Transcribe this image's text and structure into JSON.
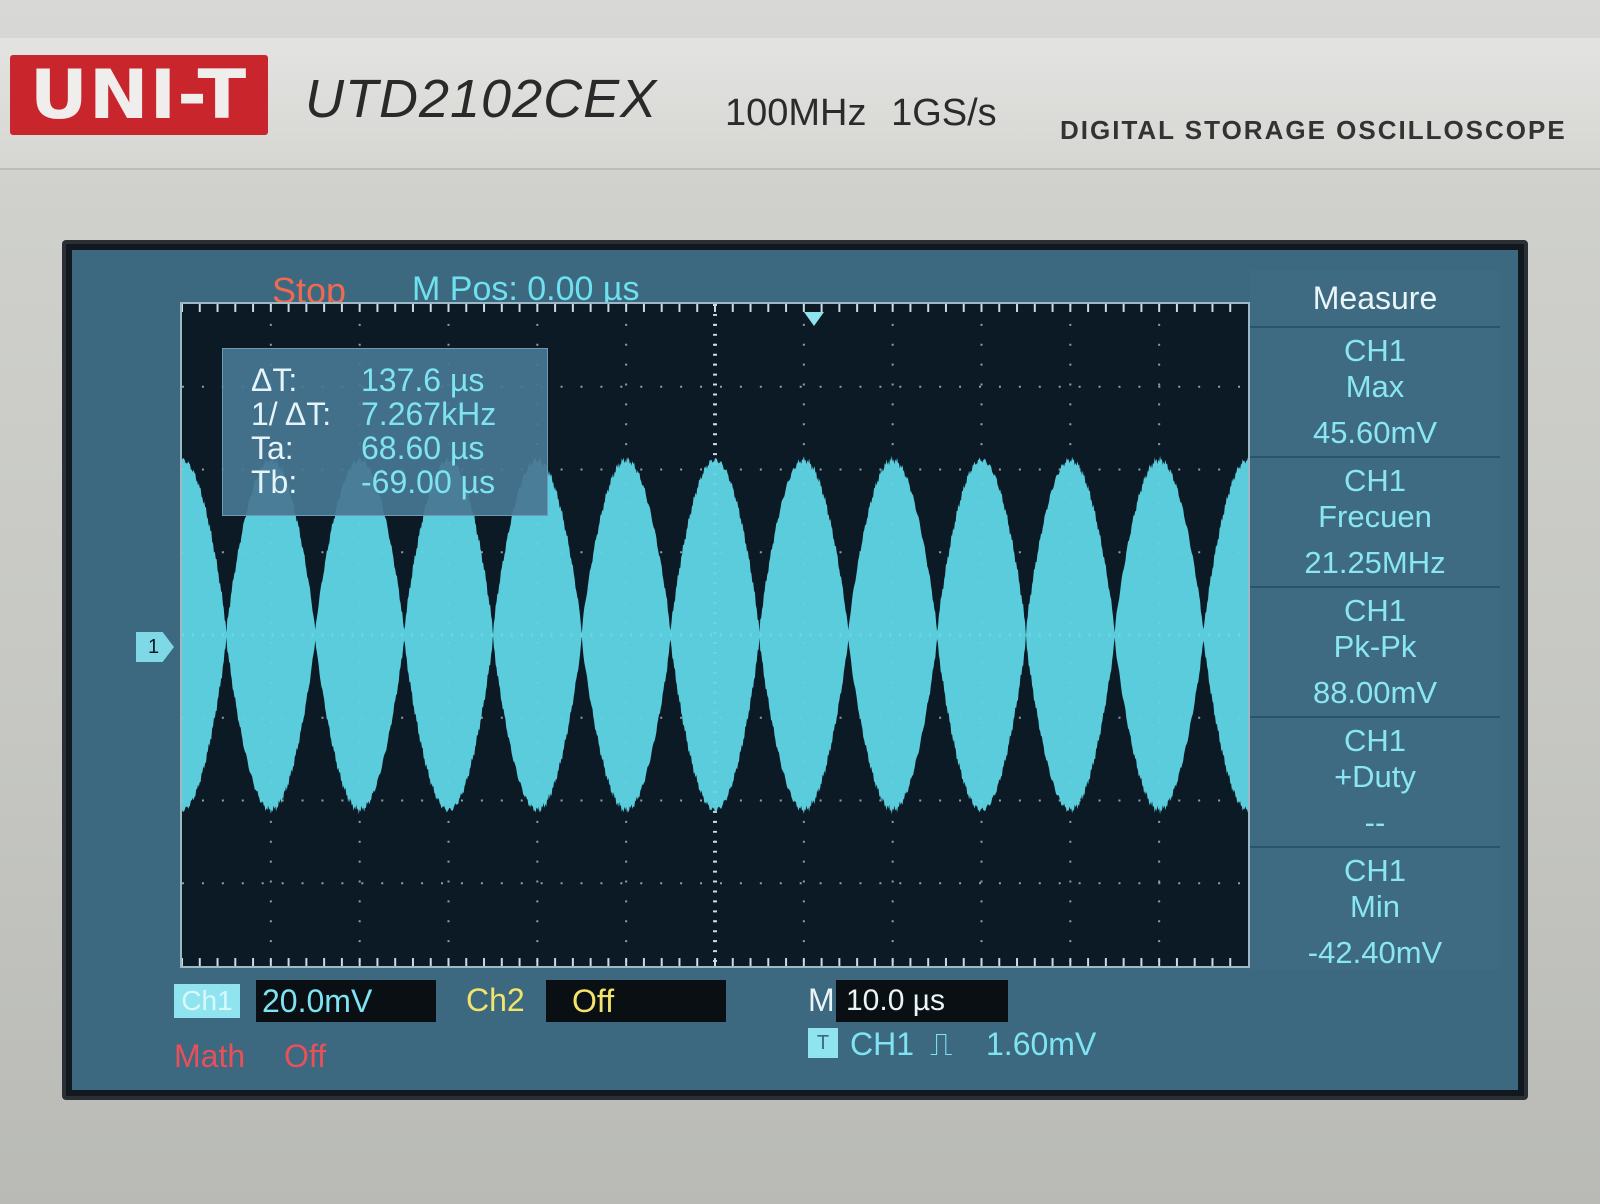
{
  "device": {
    "brand": "UNI-T",
    "model": "UTD2102CEX",
    "bandwidth": "100MHz",
    "sample_rate": "1GS/s",
    "description": "DIGITAL STORAGE OSCILLOSCOPE"
  },
  "screen": {
    "run_state": "Stop",
    "m_pos": "M Pos: 0.00 µs",
    "ch1_marker": "1"
  },
  "cursors": [
    {
      "key": "ΔT:",
      "value": "137.6 µs"
    },
    {
      "key": "1/ ΔT:",
      "value": "7.267kHz"
    },
    {
      "key": "Ta:",
      "value": "68.60 µs"
    },
    {
      "key": "Tb:",
      "value": "-69.00 µs"
    }
  ],
  "measure": {
    "title": "Measure",
    "items": [
      {
        "channel": "CH1",
        "name": "Max",
        "value": "45.60mV"
      },
      {
        "channel": "CH1",
        "name": "Frecuen",
        "value": "21.25MHz"
      },
      {
        "channel": "CH1",
        "name": "Pk-Pk",
        "value": "88.00mV"
      },
      {
        "channel": "CH1",
        "name": "+Duty",
        "value": "--"
      },
      {
        "channel": "CH1",
        "name": "Min",
        "value": "-42.40mV"
      }
    ]
  },
  "bottom": {
    "ch1_label": "Ch1",
    "ch1_scale": "20.0mV",
    "ch2_label": "Ch2",
    "ch2_state": "Off",
    "time_label": "M",
    "time_scale": "10.0 µs",
    "trigger_icon": "T",
    "trigger_source": "CH1",
    "trigger_edge": "rising-edge-icon",
    "trigger_edge_glyph": "⎍",
    "trigger_level": "1.60mV",
    "math_label": "Math",
    "math_state": "Off"
  },
  "waveform": {
    "color": "#5fd6e6",
    "cycles": 12,
    "start_phase_envelope": "peak"
  },
  "colors": {
    "trace": "#5fd6e6",
    "stop": "#f06a52",
    "ch2": "#f2e46a",
    "math": "#e8505a",
    "brand_red": "#c8252c"
  }
}
